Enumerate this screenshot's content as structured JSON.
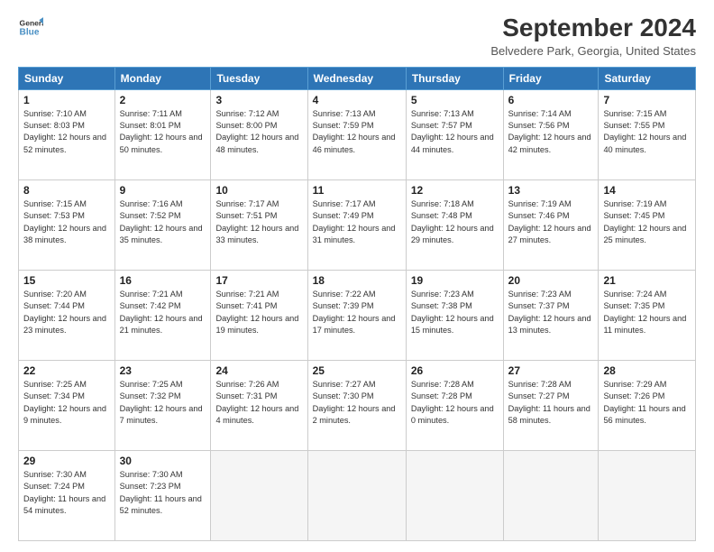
{
  "logo": {
    "line1": "General",
    "line2": "Blue"
  },
  "title": "September 2024",
  "subtitle": "Belvedere Park, Georgia, United States",
  "days_of_week": [
    "Sunday",
    "Monday",
    "Tuesday",
    "Wednesday",
    "Thursday",
    "Friday",
    "Saturday"
  ],
  "weeks": [
    [
      {
        "day": 1,
        "sunrise": "7:10 AM",
        "sunset": "8:03 PM",
        "daylight": "12 hours and 52 minutes."
      },
      {
        "day": 2,
        "sunrise": "7:11 AM",
        "sunset": "8:01 PM",
        "daylight": "12 hours and 50 minutes."
      },
      {
        "day": 3,
        "sunrise": "7:12 AM",
        "sunset": "8:00 PM",
        "daylight": "12 hours and 48 minutes."
      },
      {
        "day": 4,
        "sunrise": "7:13 AM",
        "sunset": "7:59 PM",
        "daylight": "12 hours and 46 minutes."
      },
      {
        "day": 5,
        "sunrise": "7:13 AM",
        "sunset": "7:57 PM",
        "daylight": "12 hours and 44 minutes."
      },
      {
        "day": 6,
        "sunrise": "7:14 AM",
        "sunset": "7:56 PM",
        "daylight": "12 hours and 42 minutes."
      },
      {
        "day": 7,
        "sunrise": "7:15 AM",
        "sunset": "7:55 PM",
        "daylight": "12 hours and 40 minutes."
      }
    ],
    [
      {
        "day": 8,
        "sunrise": "7:15 AM",
        "sunset": "7:53 PM",
        "daylight": "12 hours and 38 minutes."
      },
      {
        "day": 9,
        "sunrise": "7:16 AM",
        "sunset": "7:52 PM",
        "daylight": "12 hours and 35 minutes."
      },
      {
        "day": 10,
        "sunrise": "7:17 AM",
        "sunset": "7:51 PM",
        "daylight": "12 hours and 33 minutes."
      },
      {
        "day": 11,
        "sunrise": "7:17 AM",
        "sunset": "7:49 PM",
        "daylight": "12 hours and 31 minutes."
      },
      {
        "day": 12,
        "sunrise": "7:18 AM",
        "sunset": "7:48 PM",
        "daylight": "12 hours and 29 minutes."
      },
      {
        "day": 13,
        "sunrise": "7:19 AM",
        "sunset": "7:46 PM",
        "daylight": "12 hours and 27 minutes."
      },
      {
        "day": 14,
        "sunrise": "7:19 AM",
        "sunset": "7:45 PM",
        "daylight": "12 hours and 25 minutes."
      }
    ],
    [
      {
        "day": 15,
        "sunrise": "7:20 AM",
        "sunset": "7:44 PM",
        "daylight": "12 hours and 23 minutes."
      },
      {
        "day": 16,
        "sunrise": "7:21 AM",
        "sunset": "7:42 PM",
        "daylight": "12 hours and 21 minutes."
      },
      {
        "day": 17,
        "sunrise": "7:21 AM",
        "sunset": "7:41 PM",
        "daylight": "12 hours and 19 minutes."
      },
      {
        "day": 18,
        "sunrise": "7:22 AM",
        "sunset": "7:39 PM",
        "daylight": "12 hours and 17 minutes."
      },
      {
        "day": 19,
        "sunrise": "7:23 AM",
        "sunset": "7:38 PM",
        "daylight": "12 hours and 15 minutes."
      },
      {
        "day": 20,
        "sunrise": "7:23 AM",
        "sunset": "7:37 PM",
        "daylight": "12 hours and 13 minutes."
      },
      {
        "day": 21,
        "sunrise": "7:24 AM",
        "sunset": "7:35 PM",
        "daylight": "12 hours and 11 minutes."
      }
    ],
    [
      {
        "day": 22,
        "sunrise": "7:25 AM",
        "sunset": "7:34 PM",
        "daylight": "12 hours and 9 minutes."
      },
      {
        "day": 23,
        "sunrise": "7:25 AM",
        "sunset": "7:32 PM",
        "daylight": "12 hours and 7 minutes."
      },
      {
        "day": 24,
        "sunrise": "7:26 AM",
        "sunset": "7:31 PM",
        "daylight": "12 hours and 4 minutes."
      },
      {
        "day": 25,
        "sunrise": "7:27 AM",
        "sunset": "7:30 PM",
        "daylight": "12 hours and 2 minutes."
      },
      {
        "day": 26,
        "sunrise": "7:28 AM",
        "sunset": "7:28 PM",
        "daylight": "12 hours and 0 minutes."
      },
      {
        "day": 27,
        "sunrise": "7:28 AM",
        "sunset": "7:27 PM",
        "daylight": "11 hours and 58 minutes."
      },
      {
        "day": 28,
        "sunrise": "7:29 AM",
        "sunset": "7:26 PM",
        "daylight": "11 hours and 56 minutes."
      }
    ],
    [
      {
        "day": 29,
        "sunrise": "7:30 AM",
        "sunset": "7:24 PM",
        "daylight": "11 hours and 54 minutes."
      },
      {
        "day": 30,
        "sunrise": "7:30 AM",
        "sunset": "7:23 PM",
        "daylight": "11 hours and 52 minutes."
      },
      null,
      null,
      null,
      null,
      null
    ]
  ]
}
